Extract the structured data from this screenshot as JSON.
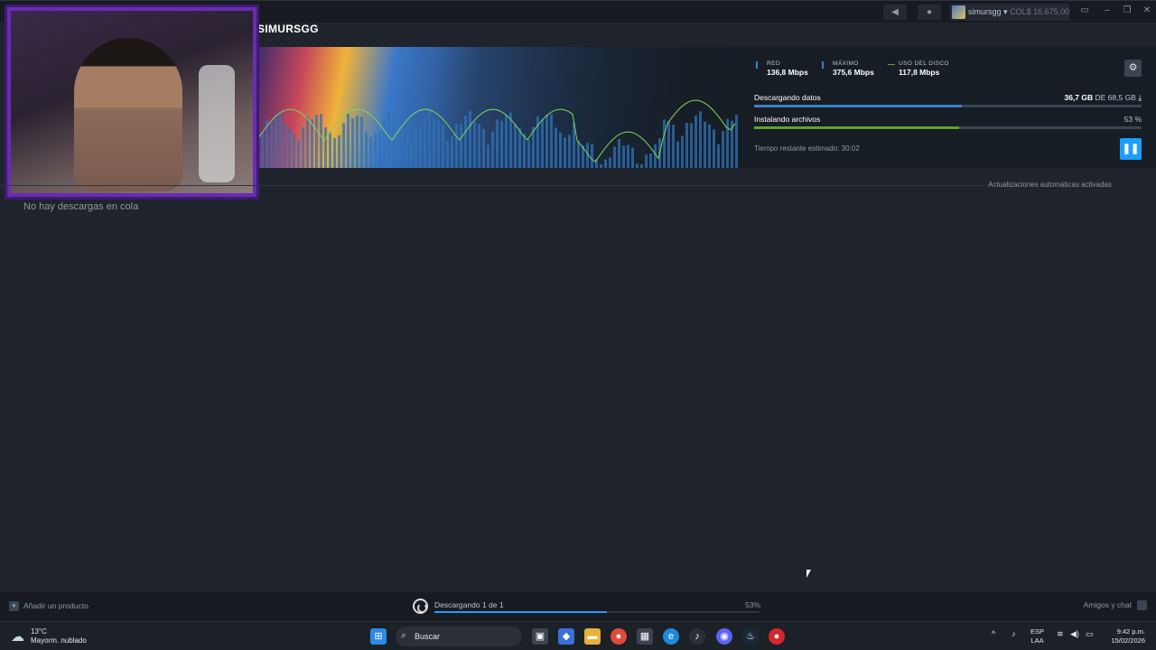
{
  "titlebar": {
    "user": {
      "name": "simursgg",
      "wallet": "COL$ 16.675,00"
    }
  },
  "game": {
    "title": "SIMURSGG"
  },
  "download": {
    "stats": [
      {
        "label": "RED",
        "value": "136,8 Mbps",
        "color": "#3b82c4"
      },
      {
        "label": "MÁXIMO",
        "value": "375,6 Mbps",
        "color": "#3b82c4"
      },
      {
        "label": "USO DEL DISCO",
        "value": "117,8 Mbps",
        "color": "#5ba32b"
      }
    ],
    "downloading_label": "Descargando datos",
    "downloading_done": "36,7 GB",
    "downloading_total": "DE 68,5 GB",
    "downloading_fraction": 0.536,
    "installing_label": "Instalando archivos",
    "installing_pct": "53 %",
    "installing_fraction": 0.53,
    "eta": "Tiempo restante estimado: 30:02"
  },
  "queue": {
    "auto_updates": "Actualizaciones automáticas activadas",
    "empty_text": "No hay descargas en cola"
  },
  "footer": {
    "add_product": "Añadir un producto",
    "status": "Descargando 1 de 1",
    "percent": "53%",
    "progress_fraction": 0.53,
    "friends": "Amigos y chat"
  },
  "taskbar": {
    "weather_temp": "13°C",
    "weather_desc": "Mayorm. nublado",
    "search": "Buscar",
    "lang_top": "ESP",
    "lang_bottom": "LAA",
    "time": "9:42 p.m.",
    "date": "15/02/2026"
  },
  "colors": {
    "accent": "#1a9fff",
    "download_bar": "#3b82c4",
    "install_bar": "#5ba32b",
    "webcam_frame": "#6b2bb5"
  }
}
